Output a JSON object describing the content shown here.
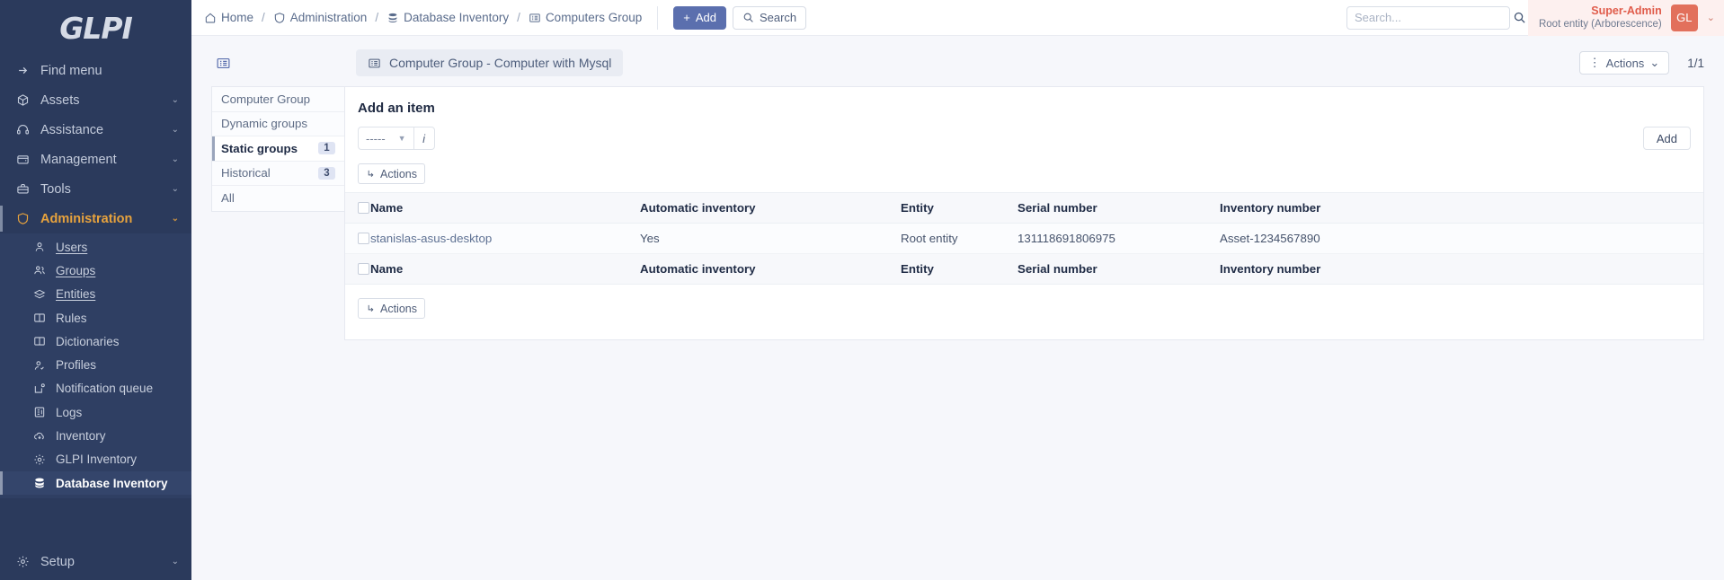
{
  "sidebar": {
    "logo": "GLPI",
    "find_menu": "Find menu",
    "items": [
      {
        "label": "Assets",
        "icon": "box-icon"
      },
      {
        "label": "Assistance",
        "icon": "headset-icon"
      },
      {
        "label": "Management",
        "icon": "wallet-icon"
      },
      {
        "label": "Tools",
        "icon": "briefcase-icon"
      },
      {
        "label": "Administration",
        "icon": "shield-icon"
      }
    ],
    "sub_items": [
      {
        "label": "Users",
        "icon": "user-icon"
      },
      {
        "label": "Groups",
        "icon": "users-icon"
      },
      {
        "label": "Entities",
        "icon": "layers-icon"
      },
      {
        "label": "Rules",
        "icon": "book-icon"
      },
      {
        "label": "Dictionaries",
        "icon": "book-open-icon"
      },
      {
        "label": "Profiles",
        "icon": "user-check-icon"
      },
      {
        "label": "Notification queue",
        "icon": "notification-icon"
      },
      {
        "label": "Logs",
        "icon": "logs-icon"
      },
      {
        "label": "Inventory",
        "icon": "cloud-download-icon"
      },
      {
        "label": "GLPI Inventory",
        "icon": "gear-icon"
      },
      {
        "label": "Database Inventory",
        "icon": "database-icon"
      }
    ],
    "setup": {
      "label": "Setup",
      "icon": "gear-icon"
    }
  },
  "topbar": {
    "breadcrumb": [
      {
        "label": "Home",
        "icon": "home-icon"
      },
      {
        "label": "Administration",
        "icon": "shield-icon"
      },
      {
        "label": "Database Inventory",
        "icon": "database-icon"
      },
      {
        "label": "Computers Group",
        "icon": "list-icon"
      }
    ],
    "separator": "/",
    "add_button": "Add",
    "add_icon": "plus-icon",
    "search_button": "Search",
    "search_icon": "search-icon",
    "search_placeholder": "Search...",
    "search_value": "",
    "user_name": "Super-Admin",
    "user_entity": "Root entity (Arborescence)",
    "avatar_initials": "GL",
    "user_caret": "chevron-down-icon"
  },
  "content": {
    "panel_toggle_icon": "list-panel-icon",
    "title": "Computer Group - Computer with Mysql",
    "title_icon": "list-icon",
    "actions_button": "Actions",
    "actions_icon": "dots-vertical-icon",
    "counter": "1/1",
    "tabs": [
      {
        "label": "Computer Group",
        "badge": ""
      },
      {
        "label": "Dynamic groups",
        "badge": ""
      },
      {
        "label": "Static groups",
        "badge": "1"
      },
      {
        "label": "Historical",
        "badge": "3"
      },
      {
        "label": "All",
        "badge": ""
      }
    ],
    "form": {
      "heading": "Add an item",
      "select_value": "-----",
      "info_label": "i",
      "add_label": "Add"
    },
    "table": {
      "actions_label": "Actions",
      "actions_icon": "arrow-action-icon",
      "columns": [
        "Name",
        "Automatic inventory",
        "Entity",
        "Serial number",
        "Inventory number"
      ],
      "rows": [
        {
          "name": "stanislas-asus-desktop",
          "automatic_inventory": "Yes",
          "entity": "Root entity",
          "serial_number": "131118691806975",
          "inventory_number": "Asset-1234567890"
        }
      ]
    }
  },
  "colors": {
    "sidebar_bg": "#2b3a5c",
    "accent_active": "#e8a33d",
    "primary_button": "#5b6fae",
    "user_accent": "#e05c4b"
  }
}
